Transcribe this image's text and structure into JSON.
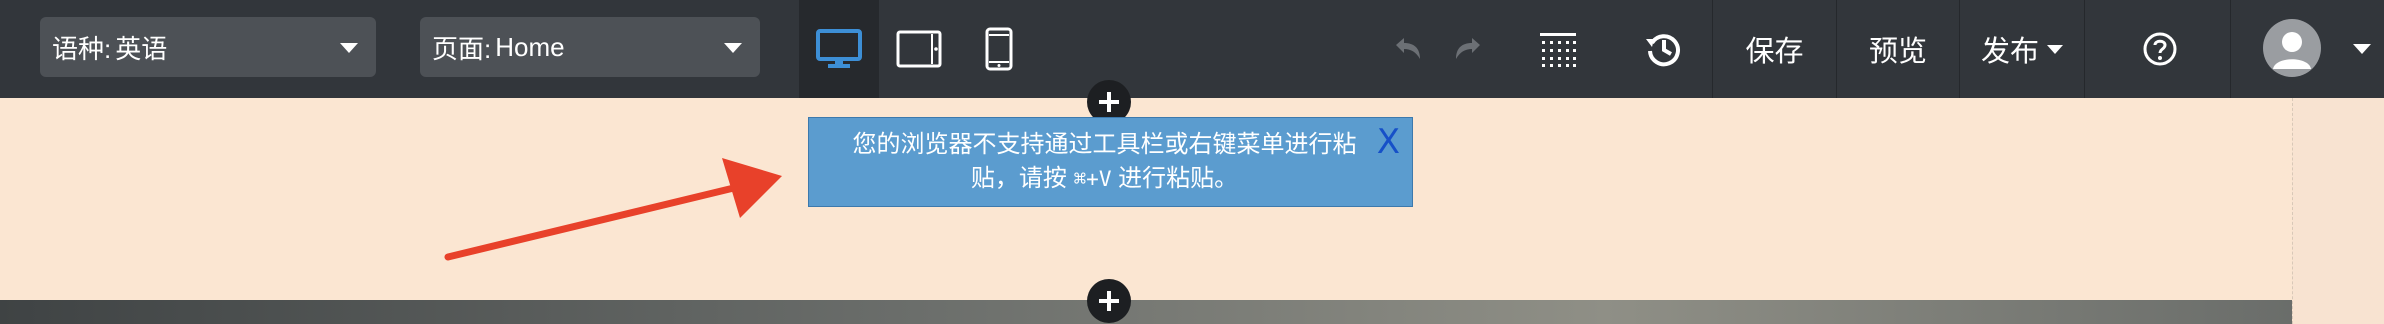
{
  "toolbar": {
    "language_select": {
      "label": "语种:",
      "value": "英语"
    },
    "page_select": {
      "label": "页面:",
      "value": "Home"
    },
    "devices": [
      {
        "name": "desktop",
        "icon": "desktop-icon",
        "active": true
      },
      {
        "name": "tablet",
        "icon": "tablet-icon",
        "active": false
      },
      {
        "name": "mobile",
        "icon": "mobile-icon",
        "active": false
      }
    ],
    "undo_icon": "undo-icon",
    "redo_icon": "redo-icon",
    "grid_icon": "grid-icon",
    "history_icon": "history-icon",
    "save_label": "保存",
    "preview_label": "预览",
    "publish_label": "发布",
    "help_icon": "help-icon",
    "avatar_icon": "user-avatar-icon"
  },
  "notice": {
    "line1": "您的浏览器不支持通过工具栏或右键菜单进行粘",
    "line2_prefix": "贴，请按 ",
    "shortcut": "⌘+V",
    "line2_suffix": " 进行粘贴。",
    "close_label": "X"
  },
  "colors": {
    "toolbar_bg": "#32363b",
    "active_device": "#3d8fd6",
    "canvas_bg": "#fbe6d2",
    "notice_bg": "#5b9ccf",
    "close_color": "#1650c8",
    "arrow_color": "#e8412a"
  }
}
